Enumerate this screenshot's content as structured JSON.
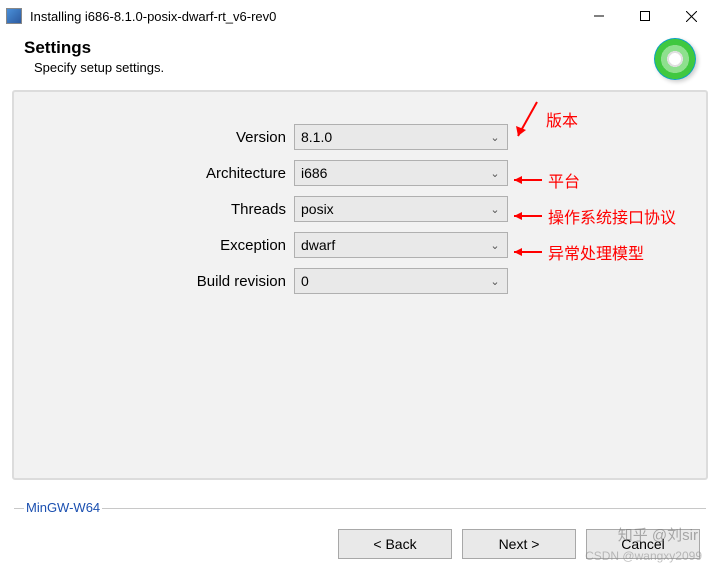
{
  "window": {
    "title": "Installing i686-8.1.0-posix-dwarf-rt_v6-rev0"
  },
  "header": {
    "title": "Settings",
    "subtitle": "Specify setup settings."
  },
  "form": {
    "version_label": "Version",
    "version_value": "8.1.0",
    "architecture_label": "Architecture",
    "architecture_value": "i686",
    "threads_label": "Threads",
    "threads_value": "posix",
    "exception_label": "Exception",
    "exception_value": "dwarf",
    "build_revision_label": "Build revision",
    "build_revision_value": "0"
  },
  "annotations": {
    "version": "版本",
    "architecture": "平台",
    "threads": "操作系统接口协议",
    "exception": "异常处理模型"
  },
  "branding": "MinGW-W64",
  "buttons": {
    "back": "< Back",
    "next": "Next >",
    "cancel": "Cancel"
  },
  "watermarks": {
    "zhihu": "知乎 @刘sir",
    "csdn": "CSDN @wangxy2099"
  }
}
